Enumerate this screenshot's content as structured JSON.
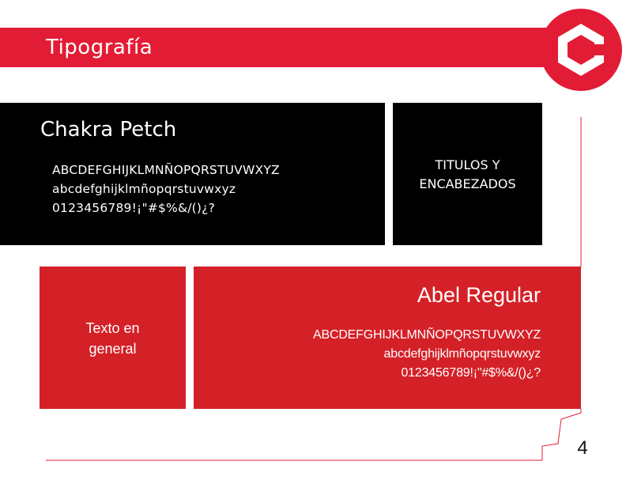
{
  "header": {
    "title": "Tipografía"
  },
  "primary_font": {
    "name": "Chakra Petch",
    "sample_lines": [
      "ABCDEFGHIJKLMNÑOPQRSTUVWXYZ",
      "abcdefghijklmñopqrstuvwxyz",
      "0123456789!¡\"#$%&/()¿?"
    ],
    "usage_line1": "TITULOS Y",
    "usage_line2": "ENCABEZADOS"
  },
  "secondary_font": {
    "name": "Abel Regular",
    "sample_lines": [
      "ABCDEFGHIJKLMNÑOPQRSTUVWXYZ",
      "abcdefghijklmñopqrstuvwxyz",
      "0123456789!¡\"#$%&/()¿?"
    ],
    "usage_line1": "Texto en",
    "usage_line2": "general"
  },
  "page_number": "4",
  "colors": {
    "brand_red": "#e31c35",
    "panel_red": "#d42027",
    "panel_black": "#000000"
  },
  "logo": {
    "icon": "hexagon-c-logo-icon"
  }
}
